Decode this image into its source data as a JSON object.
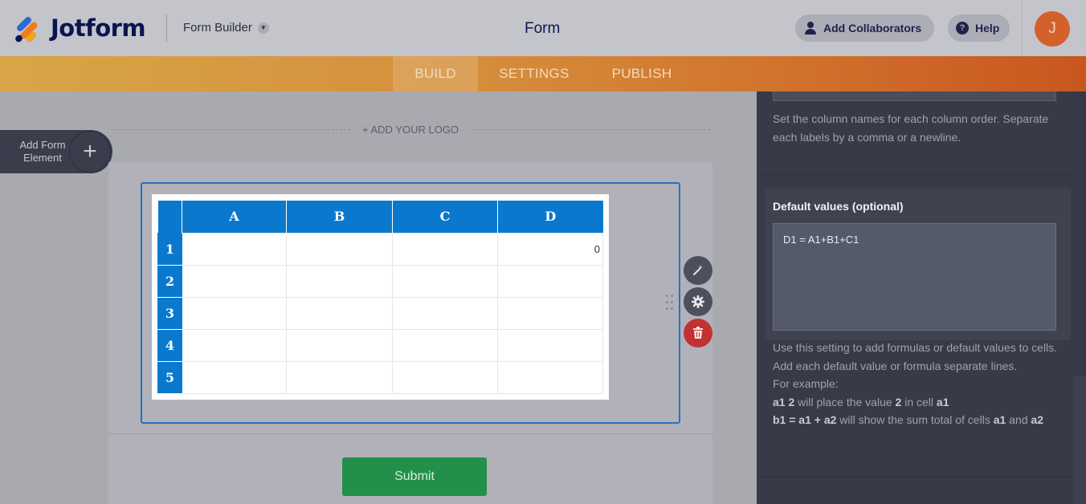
{
  "header": {
    "brand": "Jotform",
    "builder_label": "Form Builder",
    "form_title": "Form",
    "collaborators_label": "Add Collaborators",
    "help_label": "Help",
    "avatar_initial": "J"
  },
  "nav": {
    "tabs": [
      {
        "label": "BUILD",
        "active": true
      },
      {
        "label": "SETTINGS",
        "active": false
      },
      {
        "label": "PUBLISH",
        "active": false
      }
    ]
  },
  "canvas": {
    "add_logo_label": "+ ADD YOUR LOGO",
    "add_element_label": "Add Form Element",
    "add_element_icon": "plus-icon",
    "submit_label": "Submit"
  },
  "spreadsheet": {
    "columns": [
      "A",
      "B",
      "C",
      "D"
    ],
    "rows": [
      {
        "header": "1",
        "cells": [
          "",
          "",
          "",
          "0"
        ]
      },
      {
        "header": "2",
        "cells": [
          "",
          "",
          "",
          ""
        ]
      },
      {
        "header": "3",
        "cells": [
          "",
          "",
          "",
          ""
        ]
      },
      {
        "header": "4",
        "cells": [
          "",
          "",
          "",
          ""
        ]
      },
      {
        "header": "5",
        "cells": [
          "",
          "",
          "",
          ""
        ]
      }
    ]
  },
  "field_tools": [
    "magic-wand-icon",
    "gear-icon",
    "trash-icon"
  ],
  "panel": {
    "column_help": "Set the column names for each column order. Separate each labels by a comma or a newline.",
    "default_values_heading": "Default values (optional)",
    "default_values_value": "D1 = A1+B1+C1",
    "help_line1": "Use this setting to add formulas or default values to cells.",
    "help_line2": "Add each default value or formula separate lines.",
    "help_line3": "For example:",
    "example1_code": "a1 2",
    "example1_mid": " will place the value ",
    "example1_val": "2",
    "example1_tail": " in cell ",
    "example1_cell": "a1",
    "example2_code": "b1 = a1 + a2",
    "example2_mid": " will show the sum total of cells ",
    "example2_cell1": "a1",
    "example2_and": " and ",
    "example2_cell2": "a2"
  },
  "colors": {
    "accent_orange": "#d58d3a",
    "table_blue": "#0a79cd",
    "submit_green": "#22904a",
    "delete_red": "#c23232"
  }
}
